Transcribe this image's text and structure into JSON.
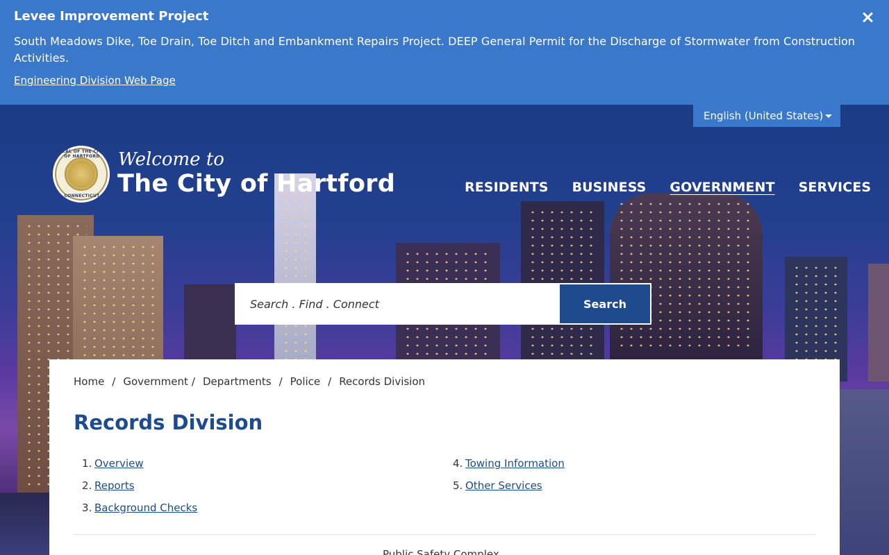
{
  "alert": {
    "title": "Levee Improvement Project",
    "body": "South Meadows Dike, Toe Drain, Toe Ditch and Embankment Repairs Project. DEEP General Permit for the Discharge of Stormwater from Construction Activities.",
    "link": "Engineering Division Web Page",
    "close_icon": "close-icon"
  },
  "language": {
    "selected": "English (United States)"
  },
  "logo": {
    "seal_top": "SEAL OF THE CITY OF HARTFORD",
    "seal_bottom": "CONNECTICUT",
    "welcome": "Welcome to",
    "city": "The City of Hartford"
  },
  "nav": {
    "items": [
      "RESIDENTS",
      "BUSINESS",
      "GOVERNMENT",
      "SERVICES"
    ],
    "active": "GOVERNMENT"
  },
  "search": {
    "placeholder": "Search . Find . Connect",
    "button": "Search"
  },
  "breadcrumb": [
    "Home",
    "Government",
    "Departments",
    "Police",
    "Records Division"
  ],
  "page": {
    "title": "Records Division",
    "toc_left": [
      {
        "num": "1.",
        "label": "Overview"
      },
      {
        "num": "2.",
        "label": "Reports "
      },
      {
        "num": "3.",
        "label": "Background Checks"
      }
    ],
    "toc_right": [
      {
        "num": "4.",
        "label": "Towing Information"
      },
      {
        "num": "5.",
        "label": "Other Services"
      }
    ],
    "footer_peek": "Public Safety Complex"
  },
  "colors": {
    "alert_bg": "#3a78cc",
    "brand_blue": "#1e4a8e",
    "link": "#1e4a8e"
  }
}
